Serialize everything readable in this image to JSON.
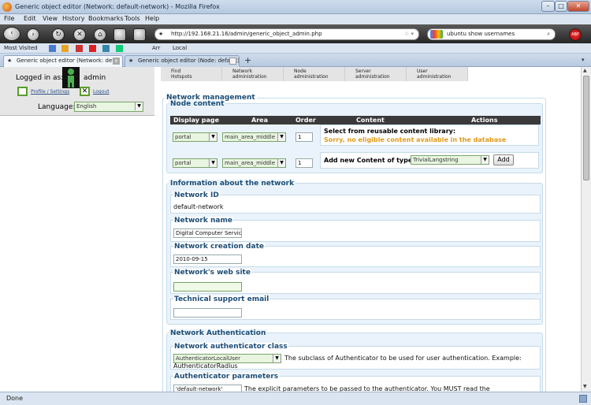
{
  "window": {
    "title": "Generic object editor (Network: default-network) - Mozilla Firefox",
    "minimize": "–",
    "maximize": "□",
    "close": "✕"
  },
  "menu": [
    "File",
    "Edit",
    "View",
    "History",
    "Bookmarks",
    "Tools",
    "Help"
  ],
  "nav": {
    "back": "‹",
    "forward": "›",
    "reload": "↻",
    "stop": "✕",
    "home": "⌂",
    "url": "http://192.168.21.16/admin/generic_object_admin.php",
    "search_value": "ubuntu show usernames",
    "search_icon": "search-icon",
    "addon_badge": "ABP"
  },
  "bookmarks": [
    "Most Visited",
    "Arr",
    "Local"
  ],
  "tabs": [
    {
      "label": "Generic object editor (Network: def..."
    },
    {
      "label": "Generic object editor (Node: default)"
    }
  ],
  "newtab": "+",
  "left": {
    "logged_in_label": "Logged in as:",
    "username": "admin",
    "profile_link": "Profile / Settings",
    "logout_link": "Logout",
    "language_label": "Language:",
    "language_value": "English"
  },
  "nav_tabs": [
    [
      "Find",
      "Hotspots"
    ],
    [
      "Network",
      "administration"
    ],
    [
      "Node",
      "administration"
    ],
    [
      "Server",
      "administration"
    ],
    [
      "User",
      "administration"
    ]
  ],
  "main": {
    "section_title": "Network management",
    "node_content": {
      "legend": "Node content",
      "headers": [
        "Display page",
        "Area",
        "Order",
        "Content",
        "Actions"
      ],
      "rows": [
        {
          "page": "portal",
          "area": "main_area_middle",
          "order": "1"
        },
        {
          "page": "portal",
          "area": "main_area_middle",
          "order": "1"
        }
      ],
      "select_library": "Select from reusable content library:",
      "no_content": "Sorry, no eligible content available in the database",
      "add_label": "Add new Content of type:",
      "add_type": "TrivialLangstring",
      "add_button": "Add"
    },
    "info": {
      "legend": "Information about the network",
      "network_id_label": "Network ID",
      "network_id": "default-network",
      "network_name_label": "Network name",
      "network_name": "Digital Computer Servic",
      "creation_date_label": "Network creation date",
      "creation_date": "2010-09-15",
      "website_label": "Network's web site",
      "website": "",
      "support_email_label": "Technical support email",
      "support_email": ""
    },
    "auth": {
      "legend": "Network Authentication",
      "class_label": "Network authenticator class",
      "class_value": "AuthenticatorLocalUser",
      "class_desc": "The subclass of Authenticator to be used for user authentication. Example:",
      "class_example": "AuthenticatorRadius",
      "params_label": "Authenticator parameters",
      "params_value": "'default-network'",
      "params_desc": "The explicit parameters to be passed to the authenticator. You MUST read the"
    }
  },
  "status": "Done"
}
